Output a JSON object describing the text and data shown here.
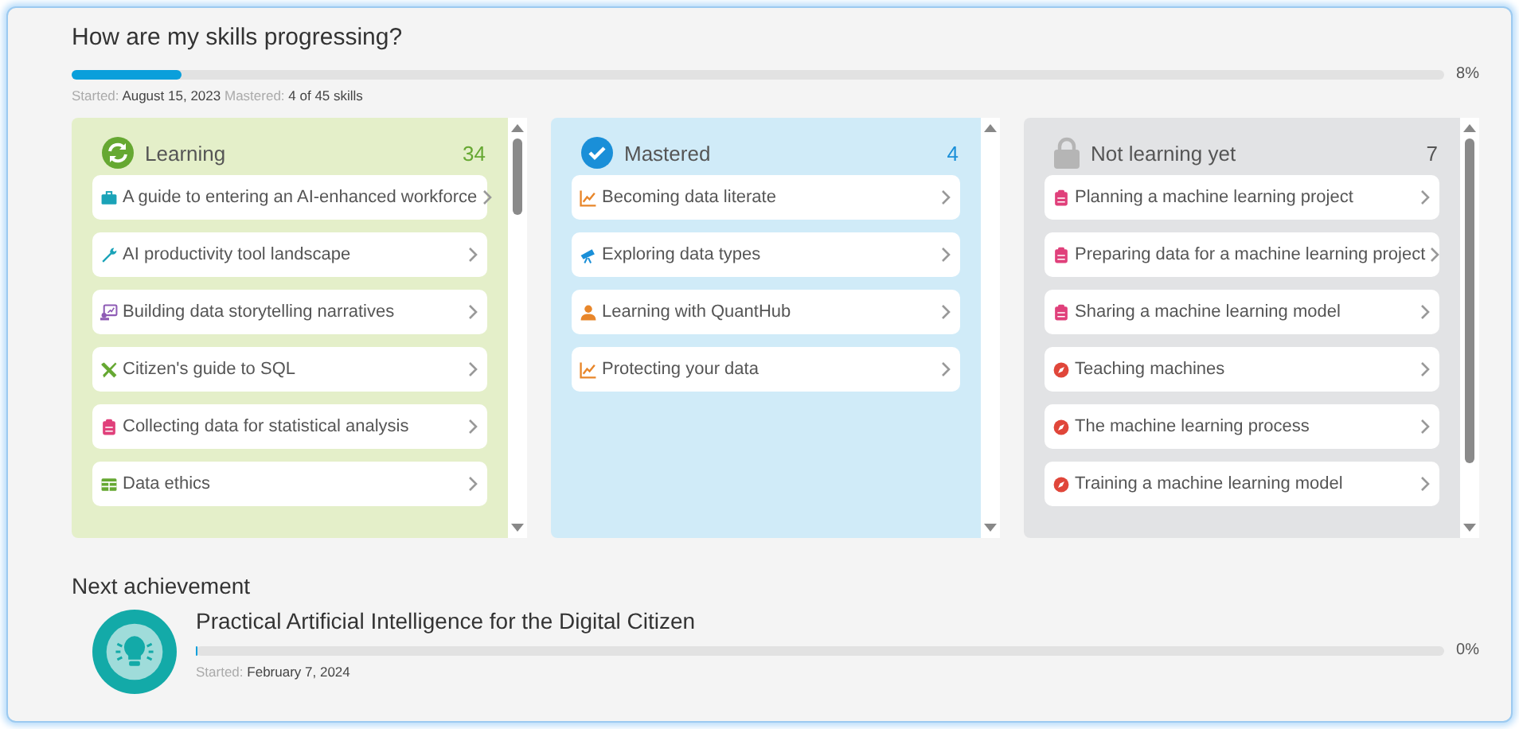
{
  "progress": {
    "title": "How are my skills progressing?",
    "level": 0.08,
    "percent": "8%",
    "started_label": "Started:",
    "started_date": "August 15, 2023",
    "mastered_label": "Mastered:",
    "mastered_value": "4 of 45 skills"
  },
  "columns": [
    {
      "kind": "learning",
      "title": "Learning",
      "count": "34",
      "items": [
        {
          "kind": "briefcase",
          "label": "A guide to entering an AI-enhanced workforce"
        },
        {
          "kind": "wrench",
          "label": "AI productivity tool landscape"
        },
        {
          "kind": "presentation",
          "label": "Building data storytelling narratives"
        },
        {
          "kind": "tools",
          "label": "Citizen's guide to SQL"
        },
        {
          "kind": "clipboard",
          "label": "Collecting data for statistical analysis"
        },
        {
          "kind": "table",
          "label": "Data ethics"
        }
      ]
    },
    {
      "kind": "mastered",
      "title": "Mastered",
      "count": "4",
      "items": [
        {
          "kind": "chart",
          "label": "Becoming data literate"
        },
        {
          "kind": "telescope",
          "label": "Exploring data types"
        },
        {
          "kind": "person",
          "label": "Learning with QuantHub"
        },
        {
          "kind": "chart",
          "label": "Protecting your data"
        }
      ]
    },
    {
      "kind": "locked",
      "title": "Not learning yet",
      "count": "7",
      "items": [
        {
          "kind": "clipboard",
          "label": "Planning a machine learning project"
        },
        {
          "kind": "clipboard",
          "label": "Preparing data for a machine learning project"
        },
        {
          "kind": "clipboard",
          "label": "Sharing a machine learning model"
        },
        {
          "kind": "compass",
          "label": "Teaching machines"
        },
        {
          "kind": "compass",
          "label": "The machine learning process"
        },
        {
          "kind": "compass",
          "label": "Training a machine learning model"
        }
      ]
    }
  ],
  "next_achievement": {
    "heading": "Next achievement",
    "title": "Practical Artificial Intelligence for the Digital Citizen",
    "level": 0,
    "percent": "0%",
    "started_label": "Started:",
    "started_date": "February 7, 2024"
  }
}
